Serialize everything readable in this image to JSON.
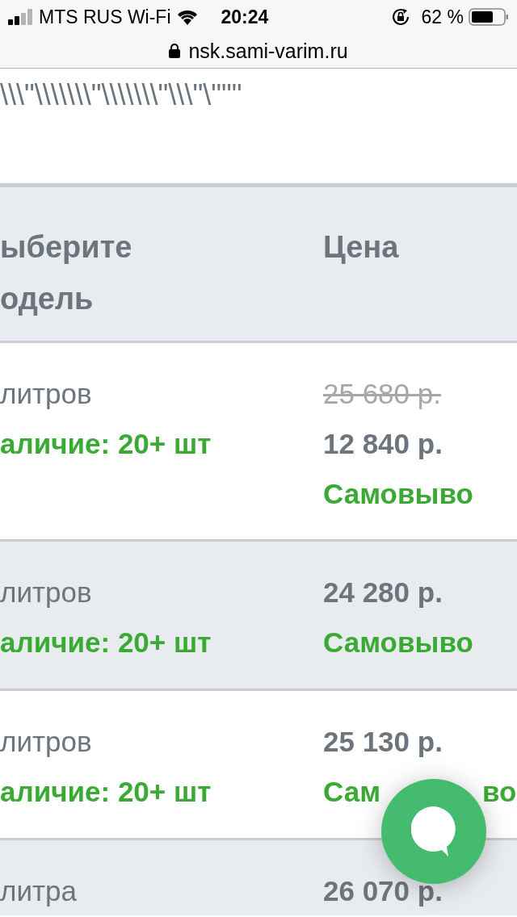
{
  "status_bar": {
    "carrier": "MTS RUS Wi-Fi",
    "time": "20:24",
    "battery": "62 %"
  },
  "address_bar": {
    "url": "nsk.sami-varim.ru"
  },
  "page_text": "\\\\\\\"\\\\\\\\\\\\\\\"\\\\\\\\\\\\\\\"\\\\\\\"\\\"\"\"",
  "table": {
    "columns": [
      {
        "lines": [
          "ыберите",
          "одель"
        ]
      },
      {
        "lines": [
          "Цена"
        ]
      }
    ],
    "rows": [
      {
        "name": "литров",
        "stock": "аличие: 20+ шт",
        "old_price": "25 680 р.",
        "price": "12 840 р.",
        "delivery": "Самовыво"
      },
      {
        "name": "литров",
        "stock": "аличие: 20+ шт",
        "price": "24 280 р.",
        "delivery": "Самовыво"
      },
      {
        "name": "литров",
        "stock": "аличие: 20+ шт",
        "price": "25 130 р.",
        "delivery": "Сам",
        "delivery_tail": "во"
      },
      {
        "name": "литра",
        "price": "26 070 р."
      }
    ]
  }
}
